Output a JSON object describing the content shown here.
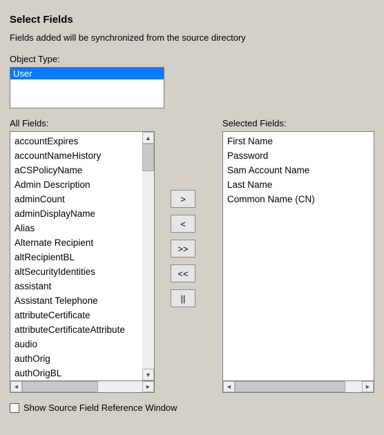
{
  "header": {
    "title": "Select Fields",
    "subtitle": "Fields added will be synchronized from the source directory"
  },
  "object_type": {
    "label": "Object Type:",
    "items": [
      "User"
    ],
    "selected": "User"
  },
  "all_fields": {
    "label": "All Fields:",
    "items": [
      "accountExpires",
      "accountNameHistory",
      "aCSPolicyName",
      "Admin Description",
      "adminCount",
      "adminDisplayName",
      "Alias",
      "Alternate Recipient",
      "altRecipientBL",
      "altSecurityIdentities",
      "assistant",
      "Assistant Telephone",
      "attributeCertificate",
      "attributeCertificateAttribute",
      "audio",
      "authOrig",
      "authOrigBL"
    ]
  },
  "selected_fields": {
    "label": "Selected Fields:",
    "items": [
      "First Name",
      "Password",
      "Sam Account Name",
      "Last Name",
      "Common Name (CN)"
    ]
  },
  "buttons": {
    "add": ">",
    "remove": "<",
    "add_all": ">>",
    "remove_all": "<<",
    "pause": "||"
  },
  "checkbox": {
    "label": "Show Source Field Reference Window",
    "checked": false
  }
}
